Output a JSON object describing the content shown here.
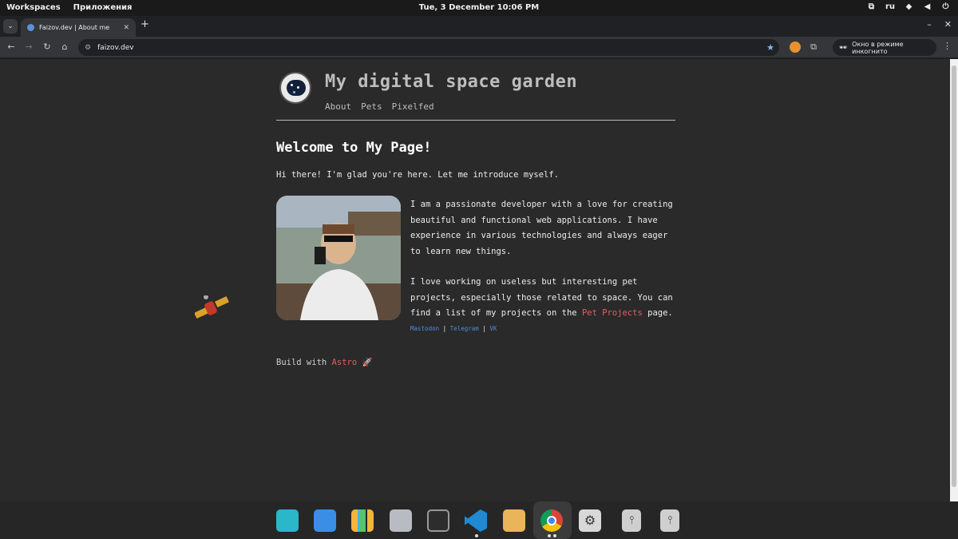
{
  "topbar": {
    "workspaces": "Workspaces",
    "apps": "Приложения",
    "clock": "Tue, 3 December  10:06 PM",
    "lang": "ru"
  },
  "browser": {
    "tab_title": "Faizov.dev | About me",
    "url": "faizov.dev",
    "incognito_label": "Окно в режиме инкогнито"
  },
  "site": {
    "title": "My digital space garden",
    "nav": [
      "About",
      "Pets",
      "Pixelfed"
    ],
    "heading": "Welcome to My Page!",
    "intro": "Hi there! I'm glad you're here. Let me introduce myself.",
    "bio_p1": "I am a passionate developer with a love for creating beautiful and functional web applications. I have experience in various technologies and always eager to learn new things.",
    "bio_p2_before": "I love working on useless but interesting pet projects, especially those related to space. You can find a list of my projects on the ",
    "bio_p2_link": "Pet Projects",
    "bio_p2_after": " page.",
    "socials": [
      "Mastodon",
      "Telegram",
      "VK"
    ],
    "social_sep": "|",
    "footer_before": "Build with ",
    "footer_link": "Astro",
    "footer_emoji": "🚀"
  },
  "dock": {
    "apps": [
      "search-app",
      "files-manager",
      "app-grid",
      "file-folder",
      "terminal",
      "vscode",
      "software-store",
      "chrome",
      "settings",
      "usb-drive",
      "usb-drive-2"
    ]
  },
  "colors": {
    "page_bg": "#2a2a2a",
    "accent_red": "#e35d5d",
    "link_blue": "#4d8cd8"
  }
}
